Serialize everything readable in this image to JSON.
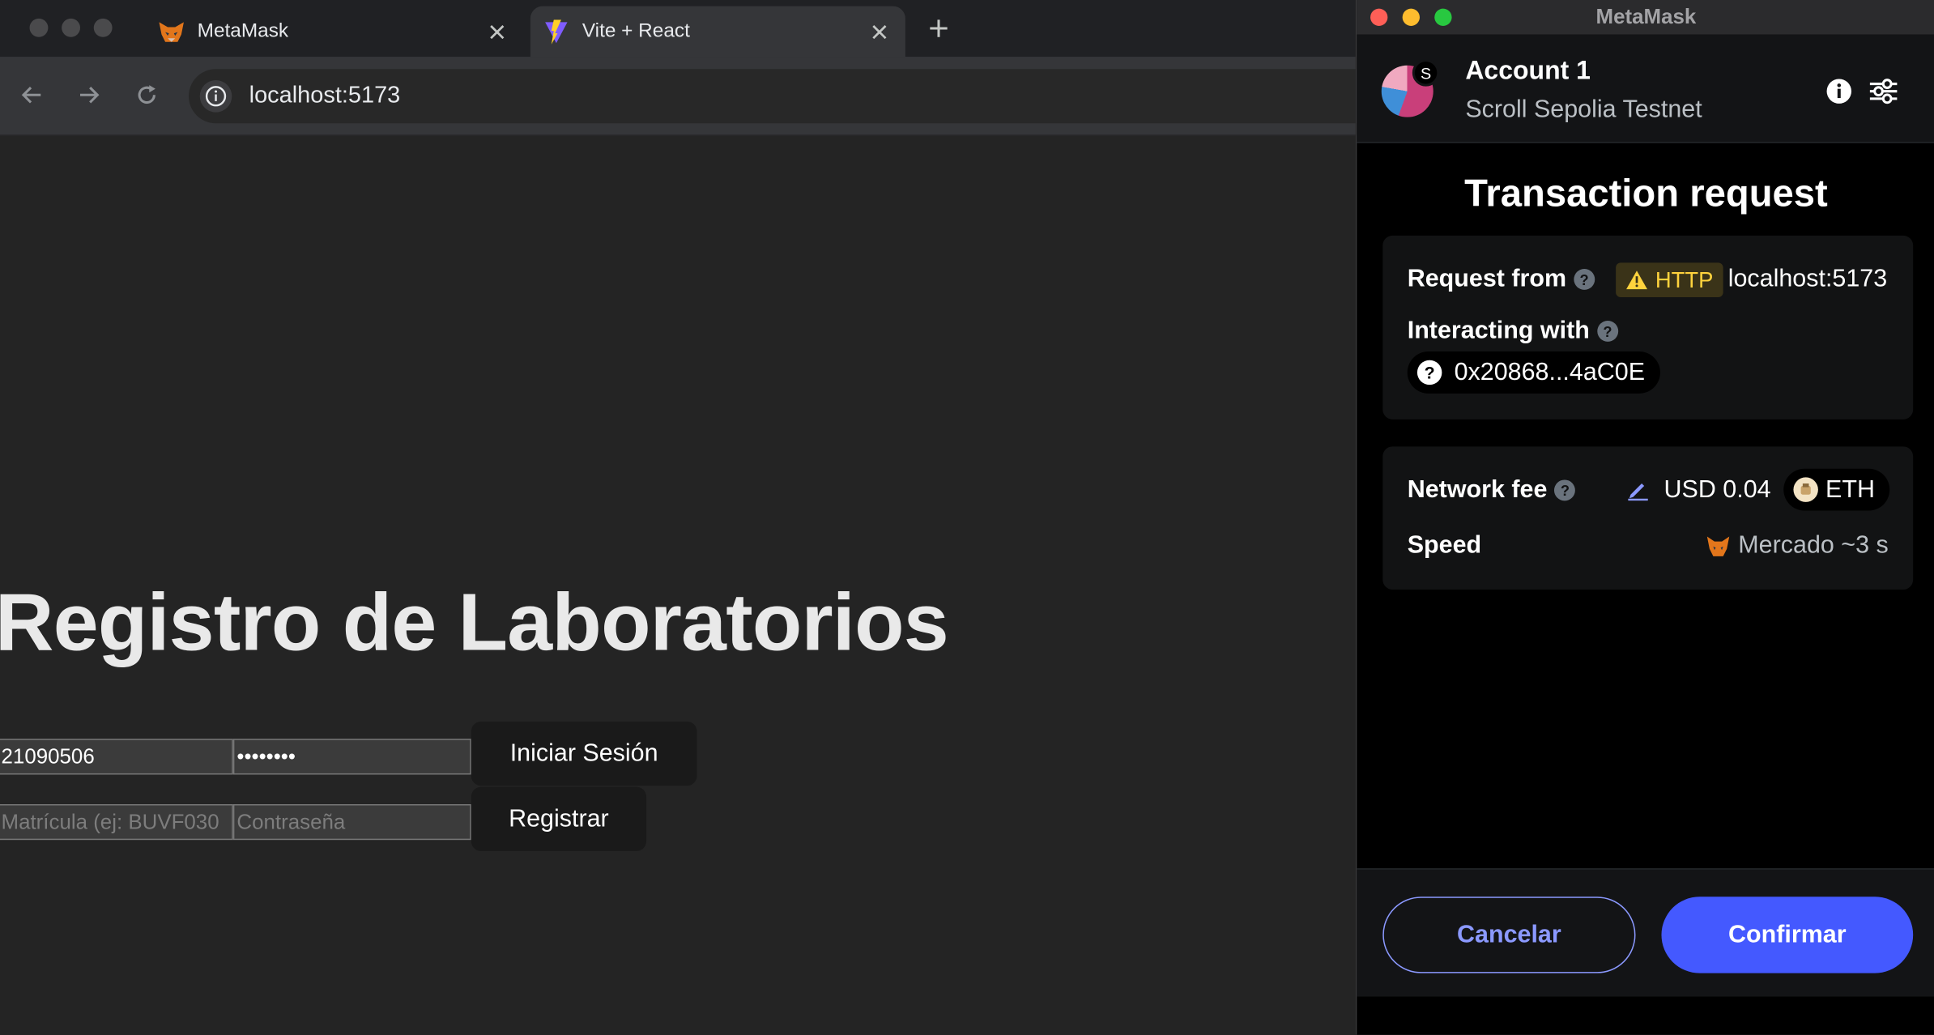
{
  "browser": {
    "tabs": [
      {
        "title": "MetaMask",
        "icon": "metamask-fox-icon"
      },
      {
        "title": "Vite + React",
        "icon": "vite-logo-icon",
        "active": true
      }
    ],
    "url": "localhost:5173"
  },
  "page": {
    "heading": "Registro de Laboratorios",
    "login": {
      "matricula_value": "21090506",
      "password_value": "••••••••",
      "button": "Iniciar Sesión"
    },
    "register": {
      "matricula_placeholder": "Matrícula (ej: BUVF030",
      "password_placeholder": "Contraseña",
      "button": "Registrar"
    }
  },
  "metamask": {
    "window_title": "MetaMask",
    "account": {
      "name": "Account 1",
      "network": "Scroll Sepolia Testnet",
      "network_badge": "S"
    },
    "title": "Transaction request",
    "request": {
      "request_from_label": "Request from",
      "protocol_badge": "HTTP",
      "origin": "localhost:5173",
      "interacting_with_label": "Interacting with",
      "contract_address": "0x20868...4aC0E"
    },
    "fee": {
      "network_fee_label": "Network fee",
      "fee_value": "USD 0.04",
      "currency": "ETH",
      "speed_label": "Speed",
      "speed_value": "Mercado ~3 s"
    },
    "actions": {
      "cancel": "Cancelar",
      "confirm": "Confirmar"
    },
    "colors": {
      "primary": "#4459ff",
      "primary_outline": "#8b99ff",
      "warning": "#ffd33d"
    }
  }
}
